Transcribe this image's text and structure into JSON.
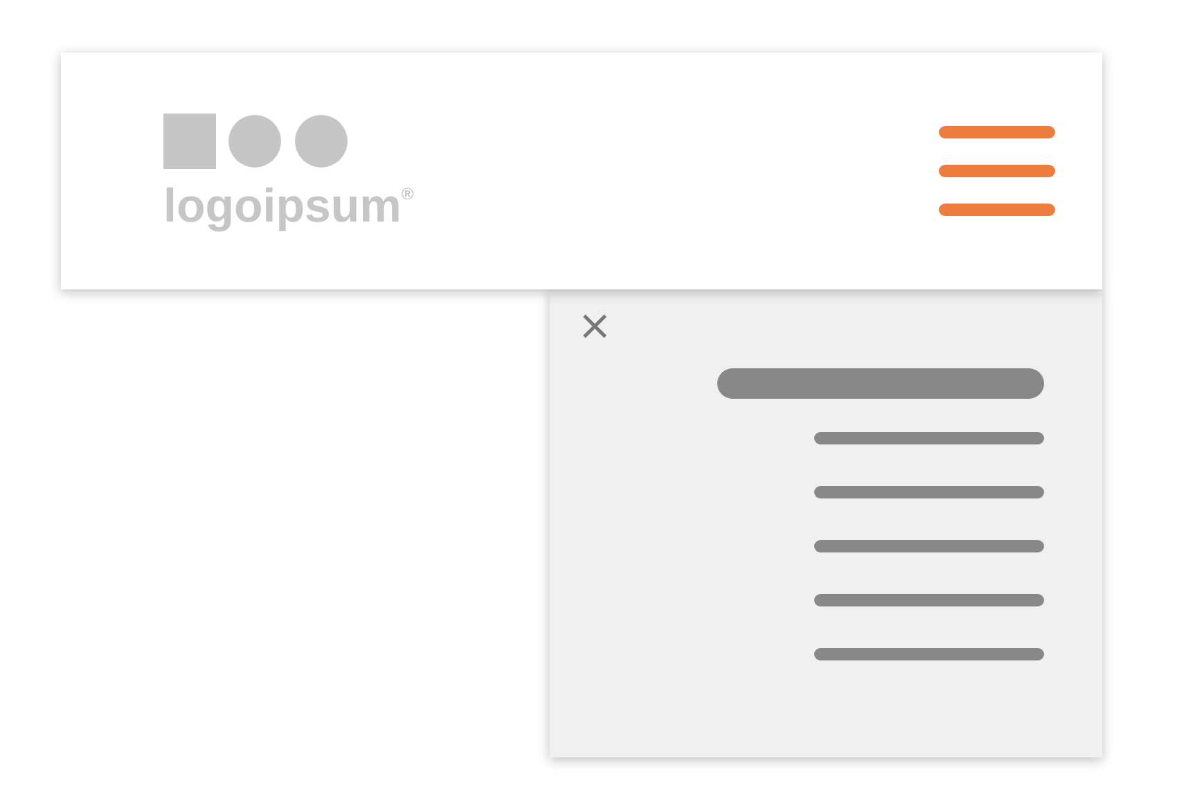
{
  "header": {
    "logo": {
      "text": "logoipsum$^{®}$"
    },
    "menu_button": {
      "expanded": true
    }
  },
  "menu": {
    "close": "×",
    "items": [
      {
        "kind": "heading"
      },
      {
        "kind": "line"
      },
      {
        "kind": "line"
      },
      {
        "kind": "line"
      },
      {
        "kind": "line"
      },
      {
        "kind": "line"
      }
    ]
  }
}
